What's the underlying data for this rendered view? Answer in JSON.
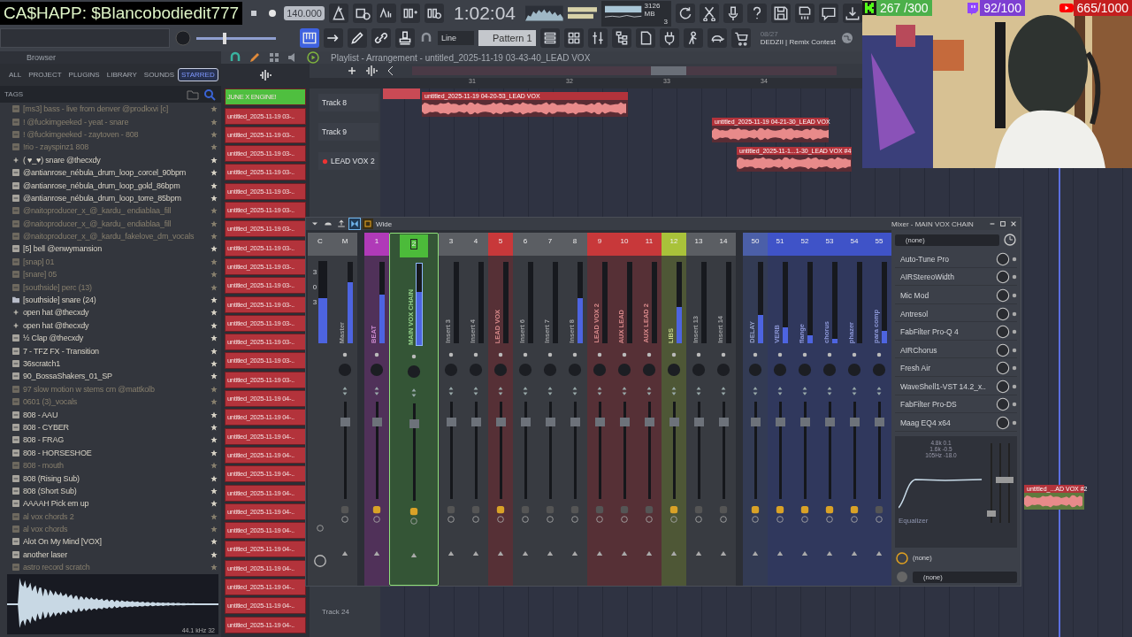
{
  "overlay": {
    "donation": "CA$HAPP: $Blancobodiedit777",
    "goals": [
      {
        "kind": "kick",
        "text": "267 /300",
        "color": "#4cb04a"
      },
      {
        "kind": "twitch",
        "text": "92/100",
        "color": "#7d3fd2"
      },
      {
        "kind": "youtube",
        "text": "665/1000",
        "color": "#c41e1e"
      }
    ]
  },
  "toolbar": {
    "pitch": {
      "level": 0.33
    },
    "tempo": "140.000",
    "time": "1:02:04",
    "memory": "3126 MB",
    "voices": "3",
    "snap": "Line",
    "pattern": "Pattern 1",
    "news_date": "08/27",
    "news": "DEDZII | Remix Contest"
  },
  "browser": {
    "title": "Browser",
    "tabs": [
      {
        "label": "ALL",
        "selected": false
      },
      {
        "label": "PROJECT",
        "selected": false
      },
      {
        "label": "PLUGINS",
        "selected": false
      },
      {
        "label": "LIBRARY",
        "selected": false
      },
      {
        "label": "SOUNDS",
        "selected": false
      },
      {
        "label": "STARRED",
        "selected": true
      }
    ],
    "tags_label": "TAGS",
    "items": [
      {
        "kind": "file",
        "name": "[ms3] bass - live from denver @prodkxvi [c]",
        "dim": true
      },
      {
        "kind": "file",
        "name": "! @fuckimgeeked - yeat - snare",
        "dim": true
      },
      {
        "kind": "file",
        "name": "! @fuckimgeeked - zaytoven - 808",
        "dim": true
      },
      {
        "kind": "file",
        "name": "!rio - zayspinz1 808",
        "dim": true
      },
      {
        "kind": "pack",
        "name": "( ♥_♥) snare @thecxdy",
        "dim": false
      },
      {
        "kind": "file",
        "name": "@antianrose_nébula_drum_loop_corcel_90bpm",
        "dim": false
      },
      {
        "kind": "file",
        "name": "@antianrose_nébula_drum_loop_gold_86bpm",
        "dim": false
      },
      {
        "kind": "file",
        "name": "@antianrose_nébula_drum_loop_torre_85bpm",
        "dim": false
      },
      {
        "kind": "file",
        "name": "@naitoproducer_x_@_kardu_ endiablaa_fill",
        "dim": true
      },
      {
        "kind": "file",
        "name": "@naitoproducer_x_@_kardu_ endiablaa_fill",
        "dim": true
      },
      {
        "kind": "file",
        "name": "@naitoproducer_x_@_kardu_fakelove_dm_vocals",
        "dim": true
      },
      {
        "kind": "file",
        "name": "[5] bell @enwymansion",
        "dim": false
      },
      {
        "kind": "file",
        "name": "[snap] 01",
        "dim": true
      },
      {
        "kind": "file",
        "name": "[snare] 05",
        "dim": true
      },
      {
        "kind": "file",
        "name": "[southside] perc (13)",
        "dim": true
      },
      {
        "kind": "folder",
        "name": "[southside] snare (24)",
        "dim": false
      },
      {
        "kind": "pack",
        "name": "open hat @thecxdy",
        "dim": false
      },
      {
        "kind": "pack",
        "name": "open hat @thecxdy",
        "dim": false
      },
      {
        "kind": "file",
        "name": "½ Clap @thecxdy",
        "dim": false
      },
      {
        "kind": "file",
        "name": "7 - TFZ FX - Transition",
        "dim": false
      },
      {
        "kind": "file",
        "name": "36scratch1",
        "dim": false
      },
      {
        "kind": "file",
        "name": "90_BossaShakers_01_SP",
        "dim": false
      },
      {
        "kind": "file",
        "name": "97 slow motion w stems cm @mattkolb",
        "dim": true
      },
      {
        "kind": "file",
        "name": "0601 (3)_vocals",
        "dim": true
      },
      {
        "kind": "file",
        "name": "808 - AAU",
        "dim": false
      },
      {
        "kind": "file",
        "name": "808 - CYBER",
        "dim": false
      },
      {
        "kind": "file",
        "name": "808 - FRAG",
        "dim": false
      },
      {
        "kind": "file",
        "name": "808 - HORSESHOE",
        "dim": false
      },
      {
        "kind": "file",
        "name": "808 - mouth",
        "dim": true
      },
      {
        "kind": "file",
        "name": "808 (Rising Sub)",
        "dim": false
      },
      {
        "kind": "file",
        "name": "808 (Short Sub)",
        "dim": false
      },
      {
        "kind": "file",
        "name": "AAAAH Pick em up",
        "dim": false
      },
      {
        "kind": "file",
        "name": "al vox chords 2",
        "dim": true
      },
      {
        "kind": "file",
        "name": "al vox chords",
        "dim": true
      },
      {
        "kind": "file",
        "name": "Alot On My Mind [VOX]",
        "dim": false
      },
      {
        "kind": "file",
        "name": "another laser",
        "dim": false
      },
      {
        "kind": "file",
        "name": "astro record scratch",
        "dim": true
      }
    ],
    "sample_info": "44.1 kHz 32"
  },
  "channel_rack": {
    "channels": [
      {
        "name": "JUNE X ENGINE!",
        "color": "#4fbf3f"
      },
      {
        "name": "untitled_2025-11-19 03-..",
        "color": "#b3333b"
      },
      {
        "name": "untitled_2025-11-19 03-..",
        "color": "#b3333b"
      },
      {
        "name": "untitled_2025-11-19 03-..",
        "color": "#b3333b"
      },
      {
        "name": "untitled_2025-11-19 03-..",
        "color": "#b3333b"
      },
      {
        "name": "untitled_2025-11-19 03-..",
        "color": "#b3333b"
      },
      {
        "name": "untitled_2025-11-19 03-..",
        "color": "#b3333b"
      },
      {
        "name": "untitled_2025-11-19 03-..",
        "color": "#b3333b"
      },
      {
        "name": "untitled_2025-11-19 03-..",
        "color": "#b3333b"
      },
      {
        "name": "untitled_2025-11-19 03-..",
        "color": "#b3333b"
      },
      {
        "name": "untitled_2025-11-19 03-..",
        "color": "#b3333b"
      },
      {
        "name": "untitled_2025-11-19 03-..",
        "color": "#b3333b"
      },
      {
        "name": "untitled_2025-11-19 03-..",
        "color": "#b3333b"
      },
      {
        "name": "untitled_2025-11-19 03-..",
        "color": "#b3333b"
      },
      {
        "name": "untitled_2025-11-19 03-..",
        "color": "#b3333b"
      },
      {
        "name": "untitled_2025-11-19 03-..",
        "color": "#b3333b"
      },
      {
        "name": "untitled_2025-11-19 04-..",
        "color": "#b3333b"
      },
      {
        "name": "untitled_2025-11-19 04-..",
        "color": "#b3333b"
      },
      {
        "name": "untitled_2025-11-19 04-..",
        "color": "#b3333b"
      },
      {
        "name": "untitled_2025-11-19 04-..",
        "color": "#b3333b"
      },
      {
        "name": "untitled_2025-11-19 04-..",
        "color": "#b3333b"
      },
      {
        "name": "untitled_2025-11-19 04-..",
        "color": "#b3333b"
      },
      {
        "name": "untitled_2025-11-19 04-..",
        "color": "#b3333b"
      },
      {
        "name": "untitled_2025-11-19 04-..",
        "color": "#b3333b"
      },
      {
        "name": "untitled_2025-11-19 04-..",
        "color": "#b3333b"
      },
      {
        "name": "untitled_2025-11-19 04-..",
        "color": "#b3333b"
      },
      {
        "name": "untitled_2025-11-19 04-..",
        "color": "#b3333b"
      },
      {
        "name": "untitled_2025-11-19 04-..",
        "color": "#b3333b"
      },
      {
        "name": "untitled_2025-11-19 04-..",
        "color": "#b3333b"
      }
    ]
  },
  "playlist": {
    "title": "Playlist - Arrangement - untitled_2025-11-19 03-43-40_LEAD VOX",
    "bars": [
      "31",
      "32",
      "33",
      "34"
    ],
    "tracks": [
      {
        "name": "Track 8",
        "armed": false,
        "clips": [
          {
            "name": "untitled_2025-11-19 04-20-53_LEAD VOX"
          }
        ]
      },
      {
        "name": "Track 9",
        "armed": false,
        "clips": [
          {
            "name": "untitled_2025-11-19 04-21-30_LEAD VOX"
          }
        ]
      },
      {
        "name": "LEAD VOX 2",
        "armed": true,
        "clips": [
          {
            "name": "untitled_2025-11-1...1-30_LEAD VOX #4"
          }
        ]
      }
    ],
    "extra_clip": {
      "name": "untitled_...AD VOX #2"
    },
    "lower_track": {
      "name": "Track 24"
    }
  },
  "mixer": {
    "title": "Mixer - MAIN VOX CHAIN",
    "stereo_mode": "Wide",
    "scale": [
      "3",
      "0",
      "3"
    ],
    "strips": [
      {
        "kind": "current",
        "number": "C",
        "color": "#5b5e63",
        "selected": false,
        "level": 0.55
      },
      {
        "kind": "master",
        "number": "M",
        "name": "Master",
        "color": "#5b5e63",
        "selected": false,
        "level": 0.75
      },
      {
        "kind": "insert",
        "number": "1",
        "name": "BEAT",
        "color": "#b03ab8",
        "selected": false,
        "level": 0.6
      },
      {
        "kind": "insert",
        "number": "2",
        "name": "MAIN VOX CHAIN",
        "color": "#4cbb3a",
        "selected": true,
        "level": 0.65
      },
      {
        "kind": "insert",
        "number": "3",
        "name": "Insert 3",
        "color": "#5b5e63",
        "selected": false,
        "level": 0
      },
      {
        "kind": "insert",
        "number": "4",
        "name": "Insert 4",
        "color": "#5b5e63",
        "selected": false,
        "level": 0
      },
      {
        "kind": "insert",
        "number": "5",
        "name": "LEAD VOX",
        "color": "#c8383a",
        "selected": false,
        "level": 0
      },
      {
        "kind": "insert",
        "number": "6",
        "name": "Insert 6",
        "color": "#5b5e63",
        "selected": false,
        "level": 0
      },
      {
        "kind": "insert",
        "number": "7",
        "name": "Insert 7",
        "color": "#5b5e63",
        "selected": false,
        "level": 0
      },
      {
        "kind": "insert",
        "number": "8",
        "name": "Insert 8",
        "color": "#5b5e63",
        "selected": false,
        "level": 0.55
      },
      {
        "kind": "insert",
        "number": "9",
        "name": "LEAD VOX 2",
        "color": "#c8383a",
        "selected": false,
        "level": 0
      },
      {
        "kind": "insert",
        "number": "10",
        "name": "AUX LEAD",
        "color": "#c8383a",
        "selected": false,
        "level": 0
      },
      {
        "kind": "insert",
        "number": "11",
        "name": "AUX LEAD 2",
        "color": "#c8383a",
        "selected": false,
        "level": 0
      },
      {
        "kind": "insert",
        "number": "12",
        "name": "LIBS",
        "color": "#a9c23a",
        "selected": false,
        "level": 0.45
      },
      {
        "kind": "insert",
        "number": "13",
        "name": "Insert 13",
        "color": "#5b5e63",
        "selected": false,
        "level": 0
      },
      {
        "kind": "insert",
        "number": "14",
        "name": "Insert 14",
        "color": "#5b5e63",
        "selected": false,
        "level": 0
      },
      {
        "kind": "bus",
        "number": "50",
        "name": "DELAY",
        "color": "#4b5fa8",
        "selected": false,
        "level": 0.35
      },
      {
        "kind": "bus",
        "number": "51",
        "name": "VERB",
        "color": "#3f53c8",
        "selected": false,
        "level": 0.2
      },
      {
        "kind": "bus",
        "number": "52",
        "name": "flange",
        "color": "#3f53c8",
        "selected": false,
        "level": 0.1
      },
      {
        "kind": "bus",
        "number": "53",
        "name": "chorus",
        "color": "#3f53c8",
        "selected": false,
        "level": 0.05
      },
      {
        "kind": "bus",
        "number": "54",
        "name": "phazer",
        "color": "#3f53c8",
        "selected": false,
        "level": 0
      },
      {
        "kind": "bus",
        "number": "55",
        "name": "para comp",
        "color": "#3f53c8",
        "selected": false,
        "level": 0.15
      }
    ],
    "fx": {
      "preset": "(none)",
      "slots": [
        "Auto-Tune Pro",
        "AIRStereoWidth",
        "Mic Mod",
        "Antresol",
        "FabFilter Pro-Q 4",
        "AIRChorus",
        "Fresh Air",
        "WaveShell1-VST 14.2_x..",
        "FabFilter Pro-DS",
        "Maag EQ4 x64"
      ],
      "eq_bands": [
        "4.8k 0.1",
        "1.6k -0.5",
        "105Hz -18.0"
      ],
      "eq_name": "Equalizer",
      "input": "(none)",
      "output": "(none)"
    }
  }
}
